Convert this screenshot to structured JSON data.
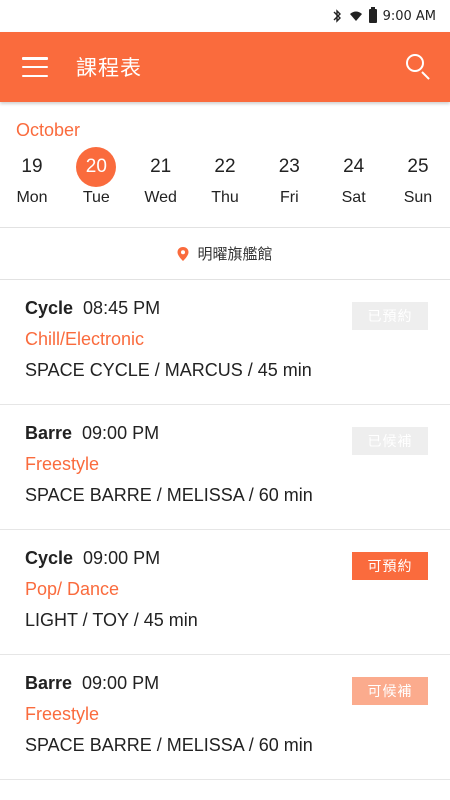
{
  "status_bar": {
    "time": "9:00 AM"
  },
  "app_bar": {
    "title": "課程表"
  },
  "calendar": {
    "month": "October",
    "days": [
      {
        "num": "19",
        "name": "Mon"
      },
      {
        "num": "20",
        "name": "Tue"
      },
      {
        "num": "21",
        "name": "Wed"
      },
      {
        "num": "22",
        "name": "Thu"
      },
      {
        "num": "23",
        "name": "Fri"
      },
      {
        "num": "24",
        "name": "Sat"
      },
      {
        "num": "25",
        "name": "Sun"
      }
    ],
    "selected_index": 1
  },
  "location": {
    "name": "明曜旗艦館"
  },
  "classes": [
    {
      "type": "Cycle",
      "time": "08:45 PM",
      "genre": "Chill/Electronic",
      "detail": "SPACE CYCLE / MARCUS / 45 min",
      "status": "已預約"
    },
    {
      "type": "Barre",
      "time": "09:00 PM",
      "genre": "Freestyle",
      "detail": "SPACE BARRE / MELISSA / 60 min",
      "status": "已候補"
    },
    {
      "type": "Cycle",
      "time": "09:00 PM",
      "genre": "Pop/ Dance",
      "detail": "LIGHT / TOY / 45 min",
      "status": "可預約"
    },
    {
      "type": "Barre",
      "time": "09:00 PM",
      "genre": "Freestyle",
      "detail": "SPACE BARRE / MELISSA / 60 min",
      "status": "可候補"
    }
  ],
  "colors": {
    "accent": "#fa6b3d",
    "booked_badge": "#eeeeee",
    "waitlist_badge": "#fbab8d"
  }
}
